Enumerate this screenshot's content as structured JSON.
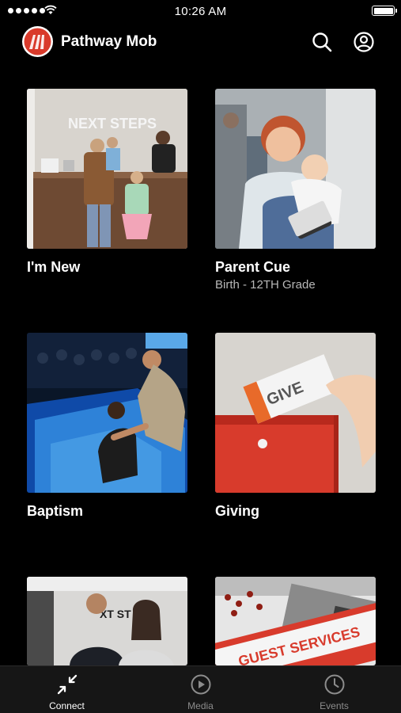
{
  "status_bar": {
    "time": "10:26 AM"
  },
  "header": {
    "title": "Pathway Mob"
  },
  "cards": [
    {
      "title": "I'm New",
      "subtitle": "",
      "image_text": "NEXT STEPS"
    },
    {
      "title": "Parent Cue",
      "subtitle": "Birth - 12TH Grade"
    },
    {
      "title": "Baptism",
      "subtitle": ""
    },
    {
      "title": "Giving",
      "subtitle": "",
      "image_text": "GIVE"
    },
    {
      "title": "",
      "subtitle": "",
      "image_text": "XT ST"
    },
    {
      "title": "",
      "subtitle": "",
      "image_text": "GUEST SERVICES"
    }
  ],
  "tabs": [
    {
      "label": "Connect",
      "icon": "connect-icon",
      "active": true
    },
    {
      "label": "Media",
      "icon": "play-circle-icon",
      "active": false
    },
    {
      "label": "Events",
      "icon": "clock-icon",
      "active": false
    }
  ],
  "colors": {
    "brand": "#d93a2b",
    "background": "#000000",
    "tab_bar": "#161616",
    "subtitle": "#b8b8b8",
    "inactive_tab": "#8c8c8c"
  }
}
